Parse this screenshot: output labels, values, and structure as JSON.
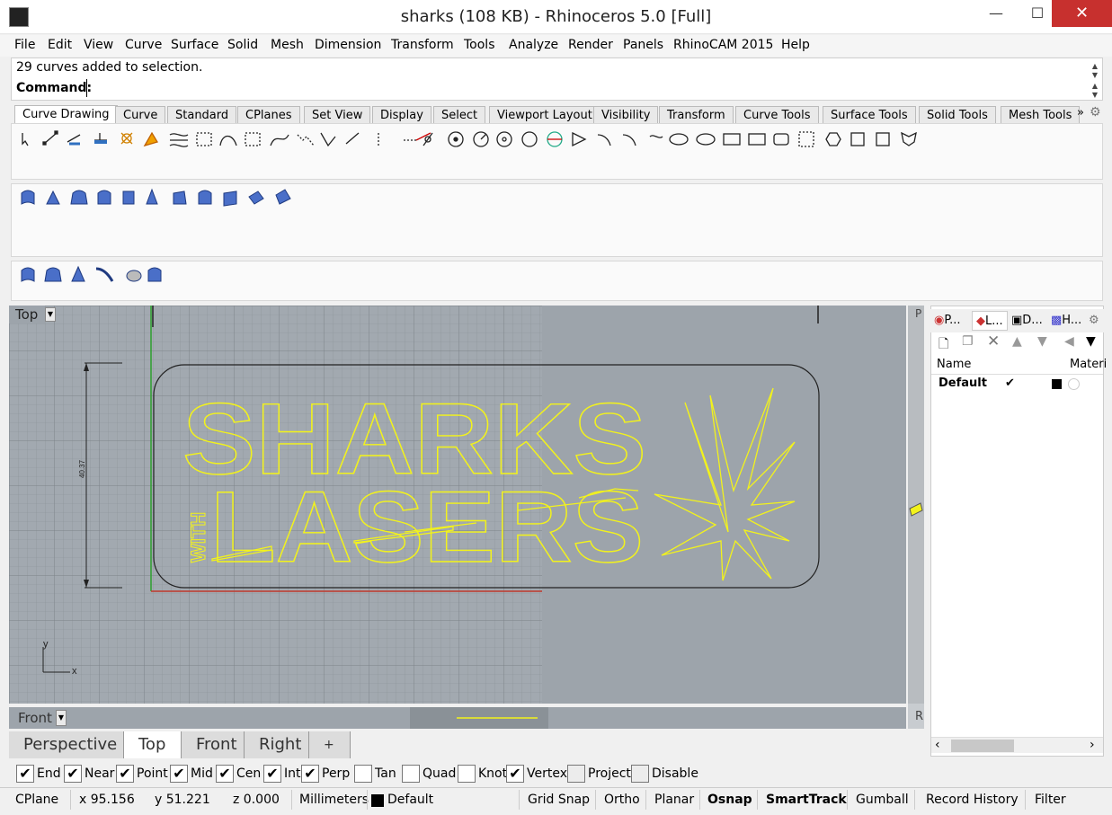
{
  "window": {
    "title": "sharks (108 KB) - Rhinoceros 5.0 [Full]",
    "minimize": "—",
    "maximize": "☐",
    "close": "✕"
  },
  "menu": [
    "File",
    "Edit",
    "View",
    "Curve",
    "Surface",
    "Solid",
    "Mesh",
    "Dimension",
    "Transform",
    "Tools",
    "Analyze",
    "Render",
    "Panels",
    "RhinoCAM 2015",
    "Help"
  ],
  "command": {
    "history": "29 curves added to selection.",
    "label": "Command:",
    "value": ""
  },
  "toolbar_tabs": [
    "Curve Drawing",
    "Curve",
    "Standard",
    "CPlanes",
    "Set View",
    "Display",
    "Select",
    "Viewport Layout",
    "Visibility",
    "Transform",
    "Curve Tools",
    "Surface Tools",
    "Solid Tools",
    "Mesh Tools"
  ],
  "toolbar_overflow": "»",
  "viewport": {
    "name": "Top",
    "dimension_text": "40.37",
    "axis_x": "x",
    "axis_y": "y",
    "side_label_top": "P",
    "side_label_bottom": "R",
    "sharks_text": "SHARKS",
    "lasers_text": "LASERS",
    "with_text": "WITH"
  },
  "front_viewport": {
    "name": "Front"
  },
  "viewport_tabs": [
    "Perspective",
    "Top",
    "Front",
    "Right"
  ],
  "viewport_tab_add": "+",
  "active_viewport_tab": "Top",
  "side_panel": {
    "tabs": [
      "P...",
      "L...",
      "D...",
      "H..."
    ],
    "columns": [
      "Name",
      "Materi"
    ],
    "layers": [
      {
        "name": "Default",
        "current": "✔",
        "color": "#000000"
      }
    ]
  },
  "osnaps": [
    {
      "label": "End",
      "checked": true
    },
    {
      "label": "Near",
      "checked": true
    },
    {
      "label": "Point",
      "checked": true
    },
    {
      "label": "Mid",
      "checked": true
    },
    {
      "label": "Cen",
      "checked": true
    },
    {
      "label": "Int",
      "checked": true
    },
    {
      "label": "Perp",
      "checked": true
    },
    {
      "label": "Tan",
      "checked": false
    },
    {
      "label": "Quad",
      "checked": false
    },
    {
      "label": "Knot",
      "checked": false
    },
    {
      "label": "Vertex",
      "checked": true
    },
    {
      "label": "Project",
      "checked": false
    },
    {
      "label": "Disable",
      "checked": false
    }
  ],
  "status": {
    "cplane": "CPlane",
    "x": "x 95.156",
    "y": "y 51.221",
    "z": "z 0.000",
    "units": "Millimeters",
    "layer": "Default",
    "grid_snap": "Grid Snap",
    "ortho": "Ortho",
    "planar": "Planar",
    "osnap": "Osnap",
    "smarttrack": "SmartTrack",
    "gumball": "Gumball",
    "record_history": "Record History",
    "filter": "Filter"
  },
  "colors": {
    "curve_yellow": "#f2f21c",
    "viewport_bg": "#9da4ab",
    "close_red": "#c7302e",
    "x_axis": "#c0392b",
    "y_axis": "#2ea02e"
  }
}
